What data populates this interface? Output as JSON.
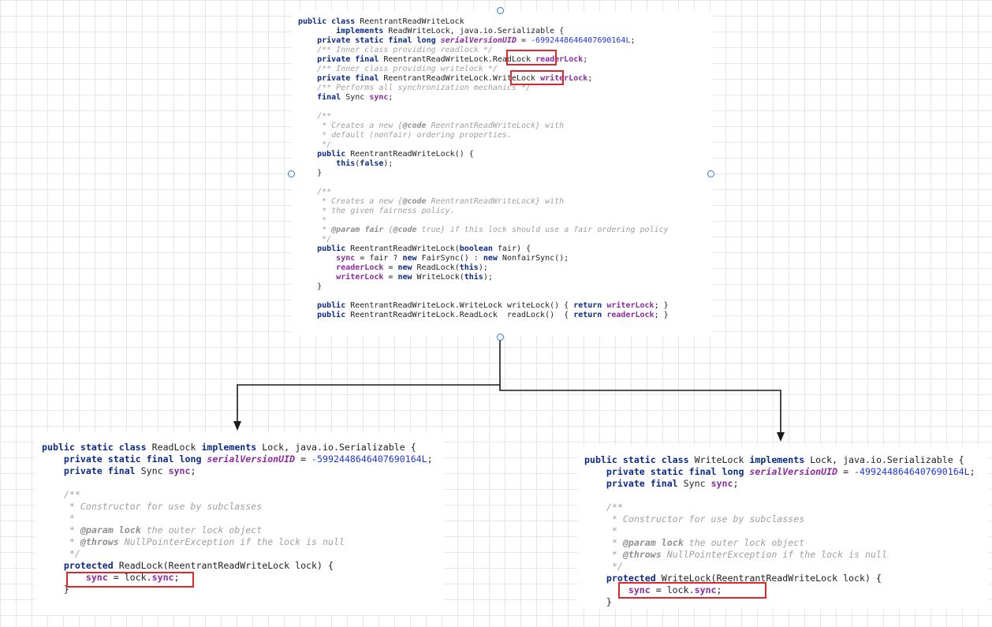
{
  "top_class": {
    "lines": [
      [
        {
          "t": "public class",
          "c": "kw"
        },
        {
          "t": " ReentrantReadWriteLock"
        }
      ],
      [
        {
          "t": "        "
        },
        {
          "t": "implements",
          "c": "kw"
        },
        {
          "t": " ReadWriteLock, java.io.Serializable {"
        }
      ],
      [
        {
          "t": "    "
        },
        {
          "t": "private static final long",
          "c": "kw"
        },
        {
          "t": " "
        },
        {
          "t": "serialVersionUID",
          "c": "sfld"
        },
        {
          "t": " = "
        },
        {
          "t": "-6992448646407690164L",
          "c": "num"
        },
        {
          "t": ";"
        }
      ],
      [
        {
          "t": "    "
        },
        {
          "t": "/** Inner class providing readlock */",
          "c": "cmt"
        }
      ],
      [
        {
          "t": "    "
        },
        {
          "t": "private final",
          "c": "kw"
        },
        {
          "t": " ReentrantReadWriteLock.ReadLock "
        },
        {
          "t": "readerLock",
          "c": "fld"
        },
        {
          "t": ";"
        }
      ],
      [
        {
          "t": "    "
        },
        {
          "t": "/** Inner class providing writelock */",
          "c": "cmt"
        }
      ],
      [
        {
          "t": "    "
        },
        {
          "t": "private final",
          "c": "kw"
        },
        {
          "t": " ReentrantReadWriteLock.WriteLock "
        },
        {
          "t": "writerLock",
          "c": "fld"
        },
        {
          "t": ";"
        }
      ],
      [
        {
          "t": "    "
        },
        {
          "t": "/** Performs all synchronization mechanics */",
          "c": "cmt"
        }
      ],
      [
        {
          "t": "    "
        },
        {
          "t": "final",
          "c": "kw"
        },
        {
          "t": " Sync "
        },
        {
          "t": "sync",
          "c": "fld"
        },
        {
          "t": ";"
        }
      ],
      [
        {
          "t": ""
        }
      ],
      [
        {
          "t": "    "
        },
        {
          "t": "/**",
          "c": "cmt"
        }
      ],
      [
        {
          "t": "     * Creates a new {",
          "c": "cmt"
        },
        {
          "t": "@code",
          "c": "tag"
        },
        {
          "t": " ReentrantReadWriteLock} with",
          "c": "cmt"
        }
      ],
      [
        {
          "t": "     * default (nonfair) ordering properties.",
          "c": "cmt"
        }
      ],
      [
        {
          "t": "     */",
          "c": "cmt"
        }
      ],
      [
        {
          "t": "    "
        },
        {
          "t": "public",
          "c": "kw"
        },
        {
          "t": " ReentrantReadWriteLock() {"
        }
      ],
      [
        {
          "t": "        "
        },
        {
          "t": "this",
          "c": "kw"
        },
        {
          "t": "("
        },
        {
          "t": "false",
          "c": "kw"
        },
        {
          "t": ");"
        }
      ],
      [
        {
          "t": "    }"
        }
      ],
      [
        {
          "t": ""
        }
      ],
      [
        {
          "t": "    "
        },
        {
          "t": "/**",
          "c": "cmt"
        }
      ],
      [
        {
          "t": "     * Creates a new {",
          "c": "cmt"
        },
        {
          "t": "@code",
          "c": "tag"
        },
        {
          "t": " ReentrantReadWriteLock} with",
          "c": "cmt"
        }
      ],
      [
        {
          "t": "     * the given fairness policy.",
          "c": "cmt"
        }
      ],
      [
        {
          "t": "     *",
          "c": "cmt"
        }
      ],
      [
        {
          "t": "     * ",
          "c": "cmt"
        },
        {
          "t": "@param",
          "c": "tag"
        },
        {
          "t": " "
        },
        {
          "t": "fair",
          "c": "tag"
        },
        {
          "t": " {",
          "c": "cmt"
        },
        {
          "t": "@code",
          "c": "tag"
        },
        {
          "t": " true} if this lock should use a fair ordering policy",
          "c": "cmt"
        }
      ],
      [
        {
          "t": "     */",
          "c": "cmt"
        }
      ],
      [
        {
          "t": "    "
        },
        {
          "t": "public",
          "c": "kw"
        },
        {
          "t": " ReentrantReadWriteLock("
        },
        {
          "t": "boolean",
          "c": "kw"
        },
        {
          "t": " fair) {"
        }
      ],
      [
        {
          "t": "        "
        },
        {
          "t": "sync",
          "c": "fld"
        },
        {
          "t": " = fair ? "
        },
        {
          "t": "new",
          "c": "kw"
        },
        {
          "t": " FairSync() : "
        },
        {
          "t": "new",
          "c": "kw"
        },
        {
          "t": " NonfairSync();"
        }
      ],
      [
        {
          "t": "        "
        },
        {
          "t": "readerLock",
          "c": "fld"
        },
        {
          "t": " = "
        },
        {
          "t": "new",
          "c": "kw"
        },
        {
          "t": " ReadLock("
        },
        {
          "t": "this",
          "c": "kw"
        },
        {
          "t": ");"
        }
      ],
      [
        {
          "t": "        "
        },
        {
          "t": "writerLock",
          "c": "fld"
        },
        {
          "t": " = "
        },
        {
          "t": "new",
          "c": "kw"
        },
        {
          "t": " WriteLock("
        },
        {
          "t": "this",
          "c": "kw"
        },
        {
          "t": ");"
        }
      ],
      [
        {
          "t": "    }"
        }
      ],
      [
        {
          "t": ""
        }
      ],
      [
        {
          "t": "    "
        },
        {
          "t": "public",
          "c": "kw"
        },
        {
          "t": " ReentrantReadWriteLock.WriteLock writeLock() { "
        },
        {
          "t": "return",
          "c": "kw"
        },
        {
          "t": " "
        },
        {
          "t": "writerLock",
          "c": "fld"
        },
        {
          "t": "; }"
        }
      ],
      [
        {
          "t": "    "
        },
        {
          "t": "public",
          "c": "kw"
        },
        {
          "t": " ReentrantReadWriteLock.ReadLock  readLock()  { "
        },
        {
          "t": "return",
          "c": "kw"
        },
        {
          "t": " "
        },
        {
          "t": "readerLock",
          "c": "fld"
        },
        {
          "t": "; }"
        }
      ]
    ]
  },
  "read_lock_class": {
    "lines": [
      [
        {
          "t": "public static class",
          "c": "kw"
        },
        {
          "t": " ReadLock "
        },
        {
          "t": "implements",
          "c": "kw"
        },
        {
          "t": " Lock, java.io.Serializable {"
        }
      ],
      [
        {
          "t": "    "
        },
        {
          "t": "private static final long",
          "c": "kw"
        },
        {
          "t": " "
        },
        {
          "t": "serialVersionUID",
          "c": "sfld"
        },
        {
          "t": " = "
        },
        {
          "t": "-5992448646407690164L",
          "c": "num"
        },
        {
          "t": ";"
        }
      ],
      [
        {
          "t": "    "
        },
        {
          "t": "private final",
          "c": "kw"
        },
        {
          "t": " Sync "
        },
        {
          "t": "sync",
          "c": "fld"
        },
        {
          "t": ";"
        }
      ],
      [
        {
          "t": ""
        }
      ],
      [
        {
          "t": "    "
        },
        {
          "t": "/**",
          "c": "cmt"
        }
      ],
      [
        {
          "t": "     * Constructor for use by subclasses",
          "c": "cmt"
        }
      ],
      [
        {
          "t": "     *",
          "c": "cmt"
        }
      ],
      [
        {
          "t": "     * ",
          "c": "cmt"
        },
        {
          "t": "@param",
          "c": "tag"
        },
        {
          "t": " "
        },
        {
          "t": "lock",
          "c": "tag"
        },
        {
          "t": " the outer lock object",
          "c": "cmt"
        }
      ],
      [
        {
          "t": "     * ",
          "c": "cmt"
        },
        {
          "t": "@throws",
          "c": "tag"
        },
        {
          "t": " NullPointerException if the lock is null",
          "c": "cmt"
        }
      ],
      [
        {
          "t": "     */",
          "c": "cmt"
        }
      ],
      [
        {
          "t": "    "
        },
        {
          "t": "protected",
          "c": "kw"
        },
        {
          "t": " ReadLock(ReentrantReadWriteLock lock) {"
        }
      ],
      [
        {
          "t": "        "
        },
        {
          "t": "sync",
          "c": "fld"
        },
        {
          "t": " = lock."
        },
        {
          "t": "sync",
          "c": "fld"
        },
        {
          "t": ";"
        }
      ],
      [
        {
          "t": "    }"
        }
      ]
    ]
  },
  "write_lock_class": {
    "lines": [
      [
        {
          "t": "public static class",
          "c": "kw"
        },
        {
          "t": " WriteLock "
        },
        {
          "t": "implements",
          "c": "kw"
        },
        {
          "t": " Lock, java.io.Serializable {"
        }
      ],
      [
        {
          "t": "    "
        },
        {
          "t": "private static final long",
          "c": "kw"
        },
        {
          "t": " "
        },
        {
          "t": "serialVersionUID",
          "c": "sfld"
        },
        {
          "t": " = "
        },
        {
          "t": "-4992448646407690164L",
          "c": "num"
        },
        {
          "t": ";"
        }
      ],
      [
        {
          "t": "    "
        },
        {
          "t": "private final",
          "c": "kw"
        },
        {
          "t": " Sync "
        },
        {
          "t": "sync",
          "c": "fld"
        },
        {
          "t": ";"
        }
      ],
      [
        {
          "t": ""
        }
      ],
      [
        {
          "t": "    "
        },
        {
          "t": "/**",
          "c": "cmt"
        }
      ],
      [
        {
          "t": "     * Constructor for use by subclasses",
          "c": "cmt"
        }
      ],
      [
        {
          "t": "     *",
          "c": "cmt"
        }
      ],
      [
        {
          "t": "     * ",
          "c": "cmt"
        },
        {
          "t": "@param",
          "c": "tag"
        },
        {
          "t": " "
        },
        {
          "t": "lock",
          "c": "tag"
        },
        {
          "t": " the outer lock object",
          "c": "cmt"
        }
      ],
      [
        {
          "t": "     * ",
          "c": "cmt"
        },
        {
          "t": "@throws",
          "c": "tag"
        },
        {
          "t": " NullPointerException if the lock is null",
          "c": "cmt"
        }
      ],
      [
        {
          "t": "     */",
          "c": "cmt"
        }
      ],
      [
        {
          "t": "    "
        },
        {
          "t": "protected",
          "c": "kw"
        },
        {
          "t": " WriteLock(ReentrantReadWriteLock lock) {"
        }
      ],
      [
        {
          "t": "        "
        },
        {
          "t": "sync",
          "c": "fld"
        },
        {
          "t": " = lock."
        },
        {
          "t": "sync",
          "c": "fld"
        },
        {
          "t": ";"
        }
      ],
      [
        {
          "t": "    }"
        }
      ]
    ]
  },
  "colors": {
    "keyword": "#0b2a87",
    "field": "#8b2aa0",
    "number": "#1c36e0",
    "comment": "#a0a0a0",
    "highlight_box": "#e0262d",
    "connector": "#1a1a1a",
    "selection_handle": "#2c7ad6"
  }
}
